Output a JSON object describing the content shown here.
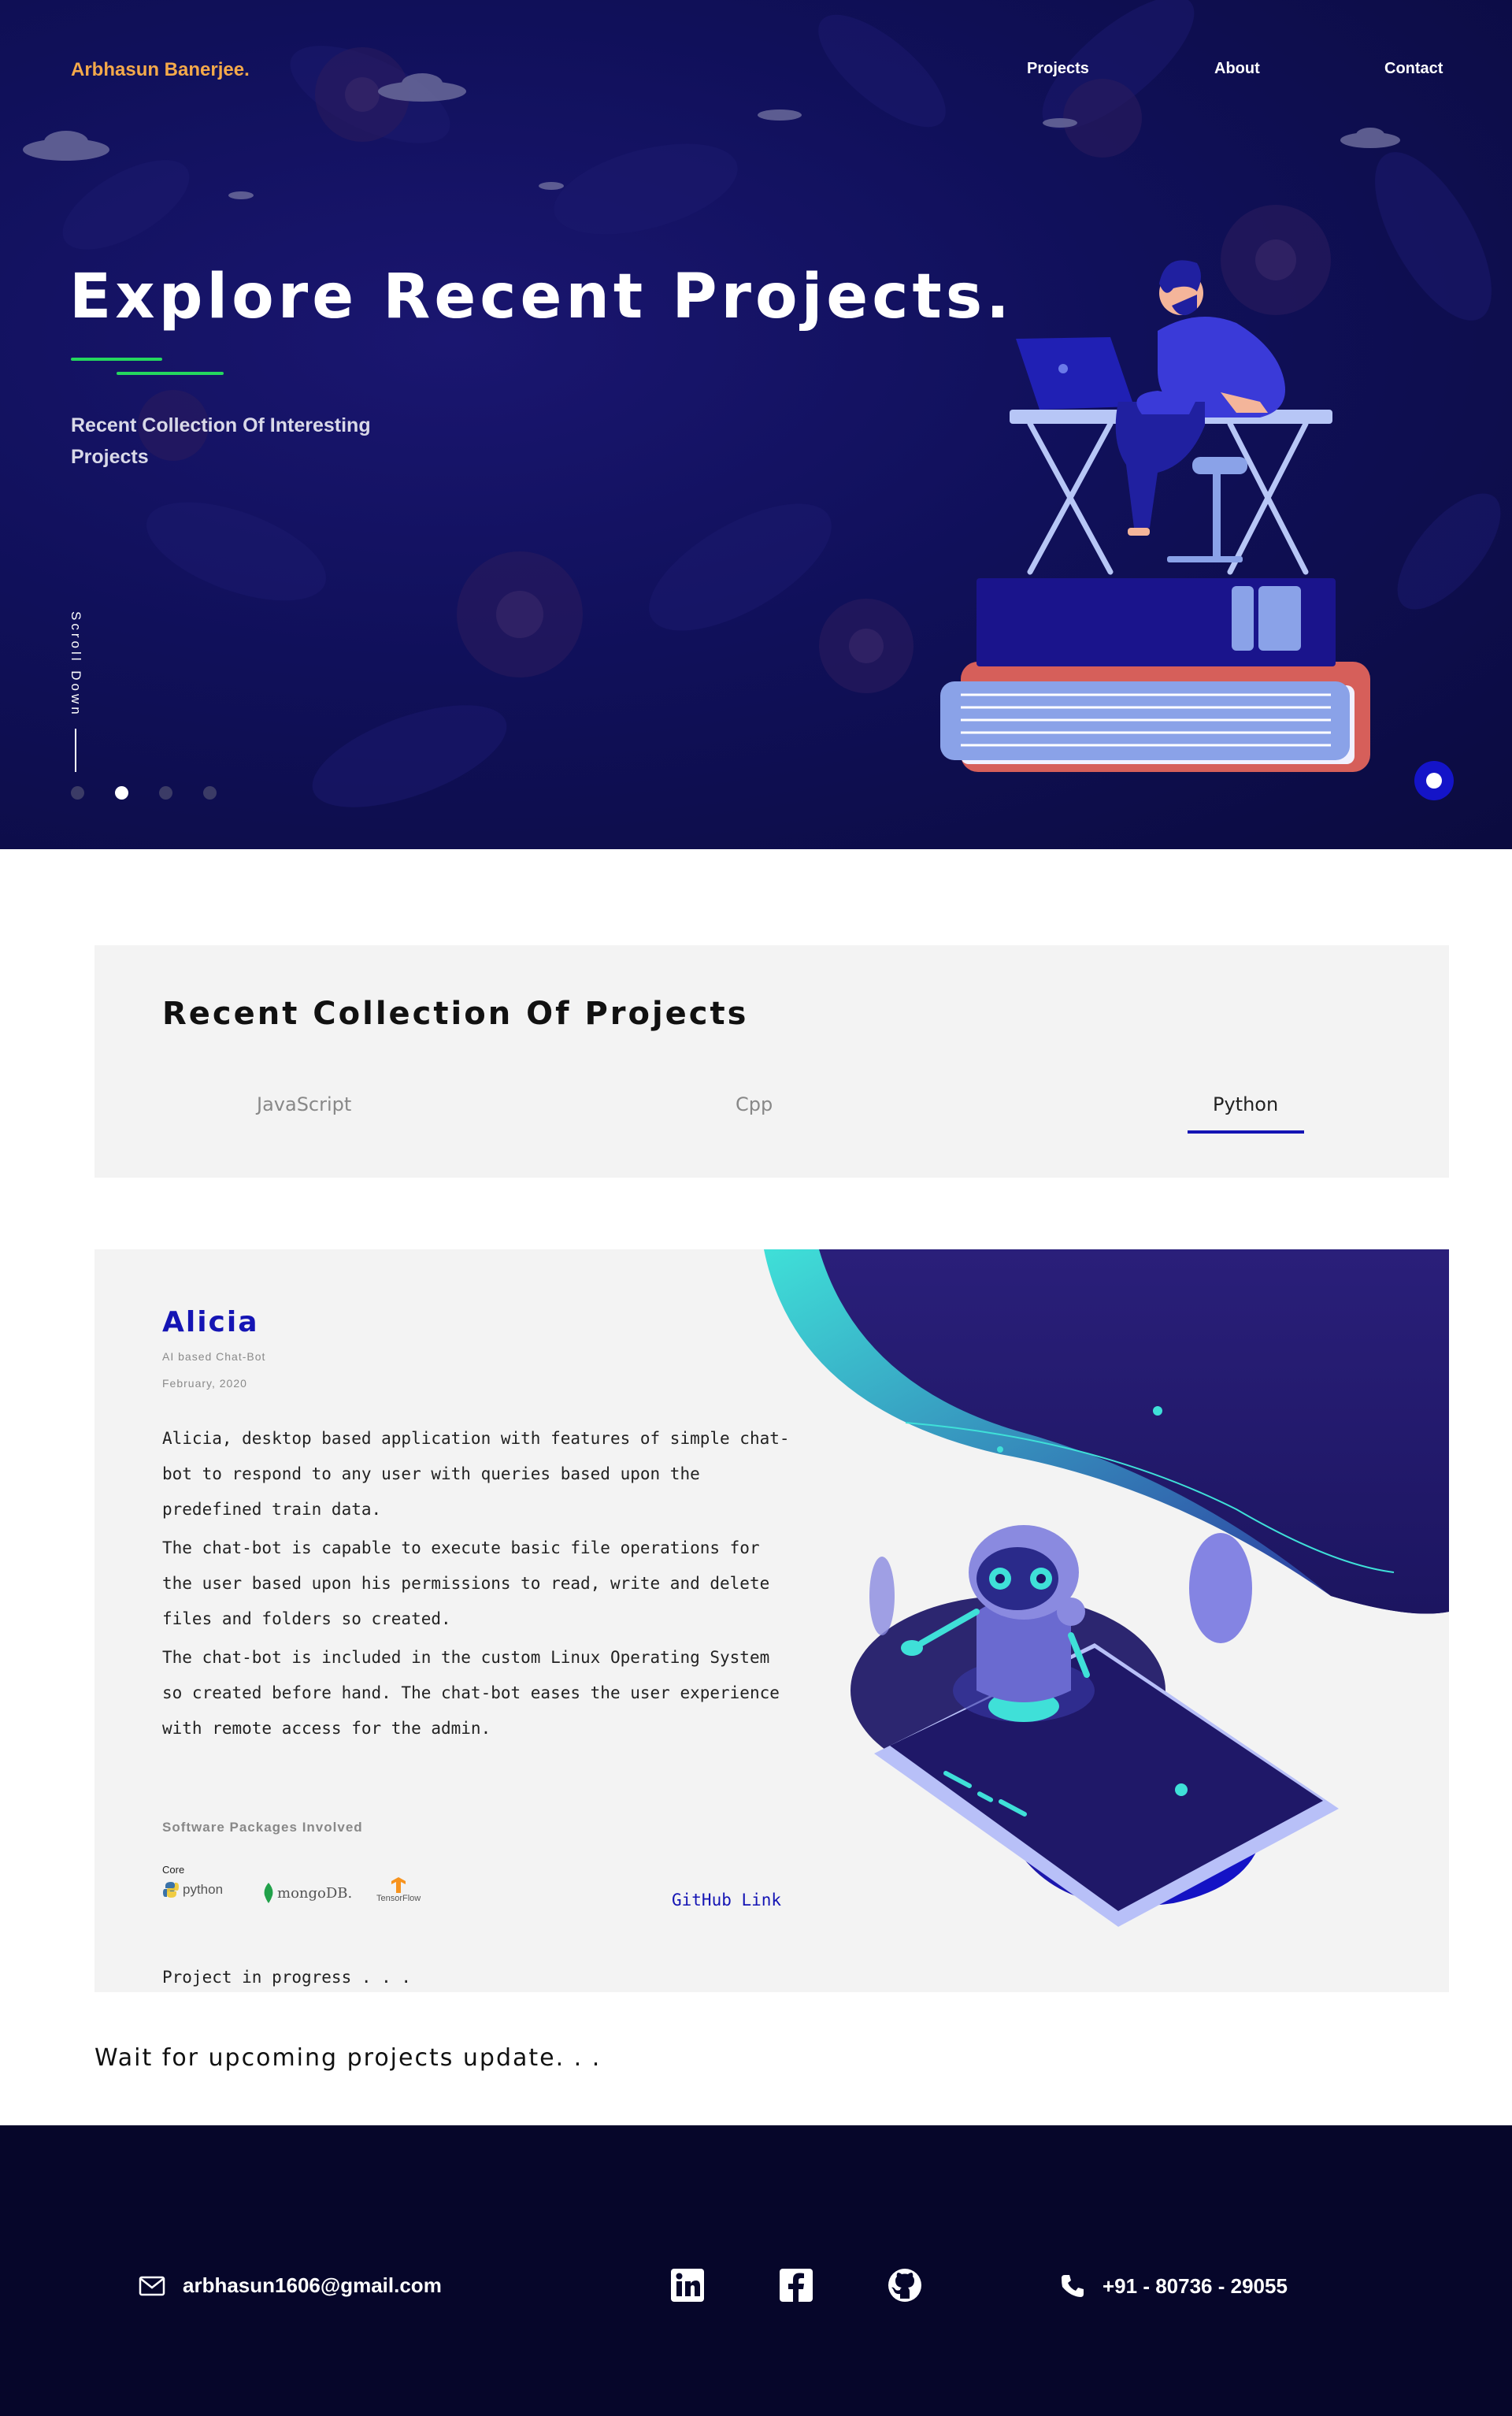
{
  "header": {
    "brand": "Arbhasun Banerjee.",
    "nav": [
      {
        "label": "Projects"
      },
      {
        "label": "About"
      },
      {
        "label": "Contact"
      }
    ]
  },
  "hero": {
    "title": "Explore Recent Projects.",
    "subtitle": "Recent Collection Of Interesting Projects",
    "scroll_label": "Scroll Down",
    "slides_total": 4,
    "active_slide": 2,
    "accent_color": "#25d85e",
    "brand_color": "#f4a94a"
  },
  "collection": {
    "title": "Recent Collection Of Projects",
    "tabs": [
      {
        "label": "JavaScript"
      },
      {
        "label": "Cpp"
      },
      {
        "label": "Python"
      }
    ],
    "active_tab": "Python",
    "active_color": "#1414b4"
  },
  "project": {
    "name": "Alicia",
    "tag": "AI based  Chat-Bot",
    "date": "February, 2020",
    "description": [
      "Alicia, desktop based application with features of simple chat-bot to respond to any user with queries based upon the predefined train data.",
      "The chat-bot is capable to execute basic file operations for the user based upon his permissions to read, write and delete files and folders so created.",
      "The chat-bot is included in the custom Linux Operating System so created before hand. The chat-bot eases the user experience with remote access for the admin."
    ],
    "packages_title": "Software Packages Involved",
    "core_label": "Core",
    "packages": [
      "python",
      "mongoDB.",
      "TensorFlow"
    ],
    "github_label": "GitHub Link",
    "status": "Project in progress . . ."
  },
  "upcoming": "Wait for upcoming projects update. . .",
  "footer": {
    "email": "arbhasun1606@gmail.com",
    "phone": "+91 - 80736 - 29055",
    "social_icons": [
      "linkedin-icon",
      "facebook-icon",
      "github-icon"
    ]
  }
}
